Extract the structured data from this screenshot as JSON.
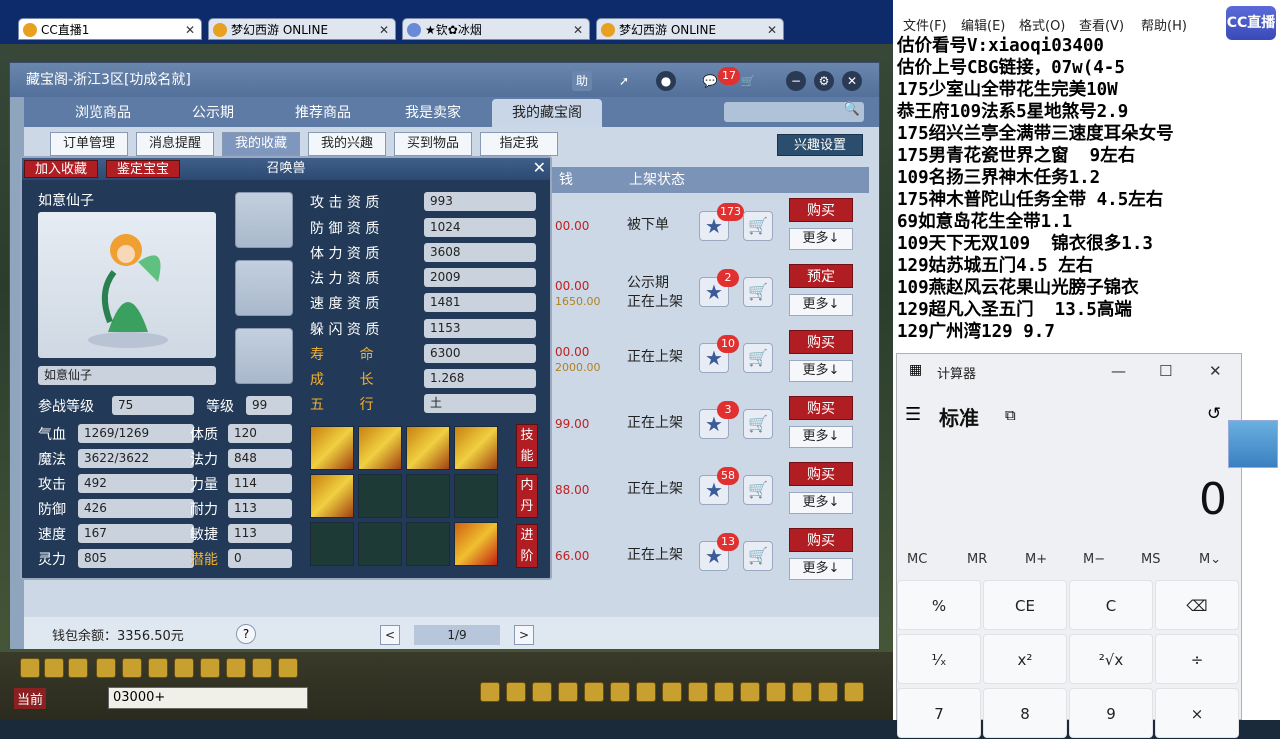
{
  "browser_tabs": [
    {
      "label": "CC直播1",
      "active": true
    },
    {
      "label": "梦幻西游 ONLINE",
      "active": false
    },
    {
      "label": "★钦✿冰烟",
      "active": false
    },
    {
      "label": "梦幻西游 ONLINE",
      "active": false
    }
  ],
  "window": {
    "title": "藏宝阁-浙江3区[功成名就]",
    "cart_badge": "17",
    "help_label": "助"
  },
  "nav_tabs": [
    "浏览商品",
    "公示期",
    "推荐商品",
    "我是卖家",
    "我的藏宝阁"
  ],
  "sub_tabs": [
    "订单管理",
    "消息提醒",
    "我的收藏",
    "我的兴趣",
    "买到物品",
    "指定我"
  ],
  "interest_settings": "兴趣设置",
  "columns": {
    "price": "钱",
    "status": "上架状态"
  },
  "rows": [
    {
      "price": "00.00",
      "price2": "",
      "status": "被下单",
      "status2": "",
      "count": "173",
      "action": "购买",
      "more": "更多↓"
    },
    {
      "price": "00.00",
      "price2": "1650.00",
      "status": "公示期",
      "status2": "正在上架",
      "count": "2",
      "action": "预定",
      "more": "更多↓"
    },
    {
      "price": "00.00",
      "price2": "2000.00",
      "status": "正在上架",
      "status2": "",
      "count": "10",
      "action": "购买",
      "more": "更多↓"
    },
    {
      "price": "99.00",
      "price2": "",
      "status": "正在上架",
      "status2": "",
      "count": "3",
      "action": "购买",
      "more": "更多↓"
    },
    {
      "price": "88.00",
      "price2": "",
      "status": "正在上架",
      "status2": "",
      "count": "58",
      "action": "购买",
      "more": "更多↓"
    },
    {
      "price": "66.00",
      "price2": "",
      "status": "正在上架",
      "status2": "",
      "count": "13",
      "action": "购买",
      "more": "更多↓"
    }
  ],
  "footer": {
    "wallet": "钱包余额：3356.50元",
    "page": "1/9",
    "help": "?",
    "prev": "<",
    "next": ">"
  },
  "pet": {
    "header": "召唤兽",
    "add_fav": "加入收藏",
    "appraise": "鉴定宝宝",
    "name_top": "如意仙子",
    "name_field": "如意仙子",
    "aptitudes": [
      {
        "label": "攻 击 资 质",
        "value": "993",
        "gold": false
      },
      {
        "label": "防 御 资 质",
        "value": "1024",
        "gold": false
      },
      {
        "label": "体 力 资 质",
        "value": "3608",
        "gold": false
      },
      {
        "label": "法 力 资 质",
        "value": "2009",
        "gold": false
      },
      {
        "label": "速 度 资 质",
        "value": "1481",
        "gold": false
      },
      {
        "label": "躲 闪 资 质",
        "value": "1153",
        "gold": false
      },
      {
        "label": "寿        命",
        "value": "6300",
        "gold": true
      },
      {
        "label": "成        长",
        "value": "1.268",
        "gold": true
      },
      {
        "label": "五        行",
        "value": "土",
        "gold": true
      }
    ],
    "level_label": "参战等级",
    "level": "75",
    "grade_label": "等级",
    "grade": "99",
    "stats_left": [
      {
        "label": "气血",
        "value": "1269/1269"
      },
      {
        "label": "魔法",
        "value": "3622/3622"
      },
      {
        "label": "攻击",
        "value": "492"
      },
      {
        "label": "防御",
        "value": "426"
      },
      {
        "label": "速度",
        "value": "167"
      },
      {
        "label": "灵力",
        "value": "805"
      }
    ],
    "stats_right": [
      {
        "label": "体质",
        "value": "120",
        "gold": false
      },
      {
        "label": "法力",
        "value": "848",
        "gold": false
      },
      {
        "label": "力量",
        "value": "114",
        "gold": false
      },
      {
        "label": "耐力",
        "value": "113",
        "gold": false
      },
      {
        "label": "敏捷",
        "value": "113",
        "gold": false
      },
      {
        "label": "潜能",
        "value": "0",
        "gold": true
      }
    ],
    "side_buttons": [
      "技能",
      "内丹",
      "进阶"
    ]
  },
  "bottom_bar": {
    "current": "当前",
    "chat_value": "03000+"
  },
  "notepad": {
    "menu": [
      "文件(F)",
      "编辑(E)",
      "格式(O)",
      "查看(V)",
      "帮助(H)"
    ],
    "lines": [
      "估价看号V:xiaoqi03400",
      "估价上号CBG链接，07w(4-5",
      "175少室山全带花生完美10W",
      "恭王府109法系5星地煞号2.9",
      "175绍兴兰亭全满带三速度耳朵女号",
      "175男青花瓷世界之窗  9左右",
      "109名扬三界神木任务1.2",
      "175神木普陀山任务全带 4.5左右",
      "69如意岛花生全带1.1",
      "109天下无双109  锦衣很多1.3",
      "129姑苏城五门4.5 左右",
      "109燕赵风云花果山光膀子锦衣",
      "129超凡入圣五门  13.5高端",
      "129广州湾129 9.7"
    ]
  },
  "cc_logo": "CC直播",
  "calculator": {
    "title": "计算器",
    "mode": "标准",
    "display": "0",
    "memory": [
      "MC",
      "MR",
      "M+",
      "M−",
      "MS",
      "M⌄"
    ],
    "keys": [
      "%",
      "CE",
      "C",
      "⌫",
      "¹⁄ₓ",
      "x²",
      "²√x",
      "÷",
      "7",
      "8",
      "9",
      "×"
    ]
  }
}
